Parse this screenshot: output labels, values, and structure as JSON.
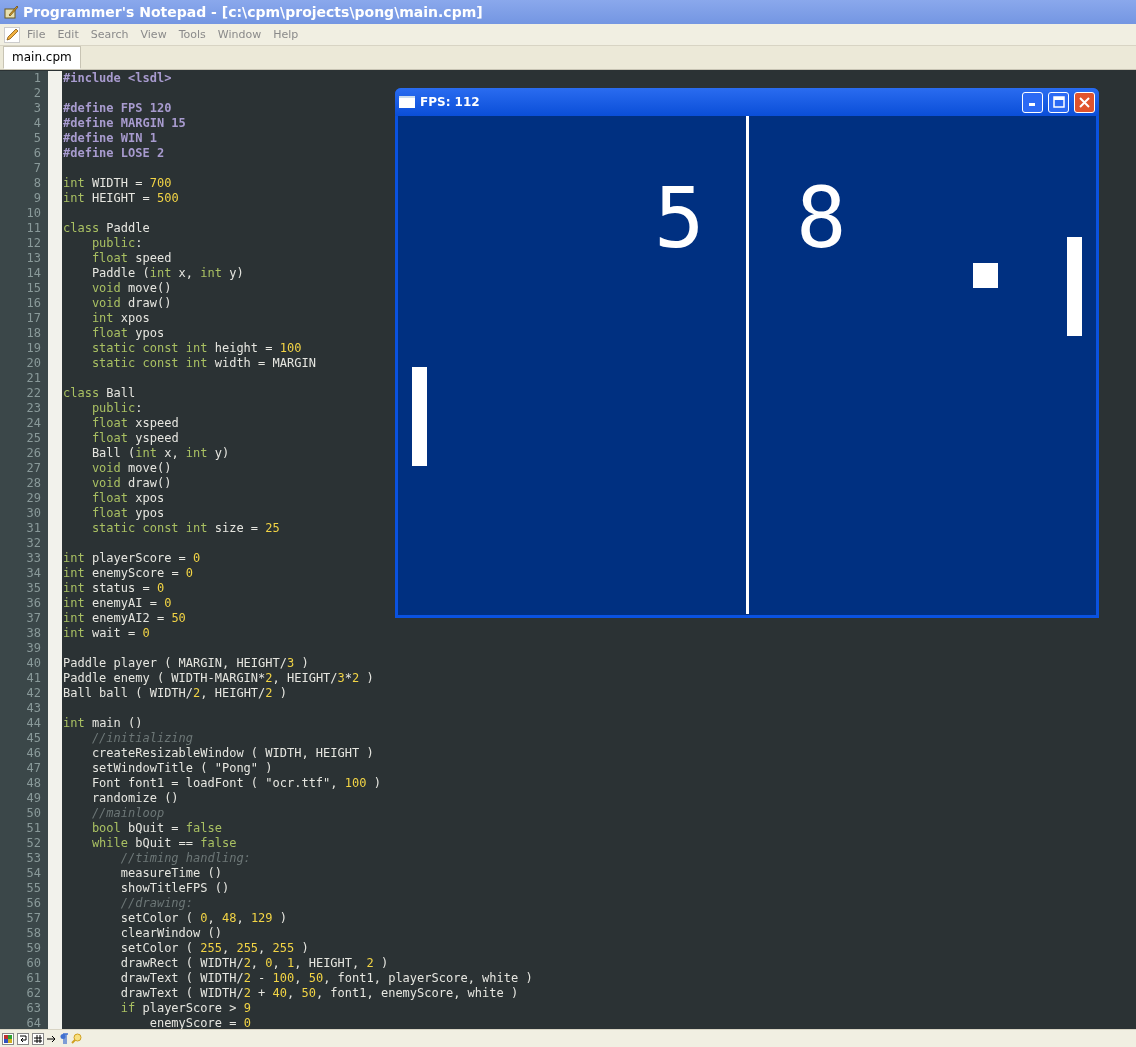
{
  "window": {
    "title": "Programmer's Notepad - [c:\\cpm\\projects\\pong\\main.cpm]"
  },
  "menu": [
    "File",
    "Edit",
    "Search",
    "View",
    "Tools",
    "Window",
    "Help"
  ],
  "tabs": [
    {
      "label": "main.cpm",
      "selected": true
    }
  ],
  "code_lines": [
    {
      "number": "1",
      "tokens": [
        {
          "kind": "pp",
          "text": "#include <lsdl>"
        }
      ]
    },
    {
      "number": "2"
    },
    {
      "number": "3",
      "tokens": [
        {
          "kind": "pp",
          "text": "#define FPS 120"
        }
      ]
    },
    {
      "number": "4",
      "tokens": [
        {
          "kind": "pp",
          "text": "#define MARGIN 15"
        }
      ]
    },
    {
      "number": "5",
      "tokens": [
        {
          "kind": "pp",
          "text": "#define WIN 1"
        }
      ]
    },
    {
      "number": "6",
      "tokens": [
        {
          "kind": "pp",
          "text": "#define LOSE 2"
        }
      ]
    },
    {
      "number": "7"
    },
    {
      "number": "8",
      "tokens": [
        {
          "kind": "kw",
          "text": "int"
        },
        {
          "kind": "plain",
          "text": " WIDTH = "
        },
        {
          "kind": "num",
          "text": "700"
        }
      ]
    },
    {
      "number": "9",
      "tokens": [
        {
          "kind": "kw",
          "text": "int"
        },
        {
          "kind": "plain",
          "text": " HEIGHT = "
        },
        {
          "kind": "num",
          "text": "500"
        }
      ]
    },
    {
      "number": "10"
    },
    {
      "number": "11",
      "tokens": [
        {
          "kind": "kw",
          "text": "class"
        },
        {
          "kind": "plain",
          "text": " Paddle"
        }
      ]
    },
    {
      "number": "12",
      "tokens": [
        {
          "kind": "kw",
          "text": "    public"
        },
        {
          "kind": "plain",
          "text": ":"
        }
      ]
    },
    {
      "number": "13",
      "tokens": [
        {
          "kind": "kw",
          "text": "    float"
        },
        {
          "kind": "plain",
          "text": " speed"
        }
      ]
    },
    {
      "number": "14",
      "tokens": [
        {
          "kind": "plain",
          "text": "    Paddle ("
        },
        {
          "kind": "kw",
          "text": "int"
        },
        {
          "kind": "plain",
          "text": " x, "
        },
        {
          "kind": "kw",
          "text": "int"
        },
        {
          "kind": "plain",
          "text": " y)"
        }
      ]
    },
    {
      "number": "15",
      "tokens": [
        {
          "kind": "kw",
          "text": "    void"
        },
        {
          "kind": "plain",
          "text": " move()"
        }
      ]
    },
    {
      "number": "16",
      "tokens": [
        {
          "kind": "kw",
          "text": "    void"
        },
        {
          "kind": "plain",
          "text": " draw()"
        }
      ]
    },
    {
      "number": "17",
      "tokens": [
        {
          "kind": "kw",
          "text": "    int"
        },
        {
          "kind": "plain",
          "text": " xpos"
        }
      ]
    },
    {
      "number": "18",
      "tokens": [
        {
          "kind": "kw",
          "text": "    float"
        },
        {
          "kind": "plain",
          "text": " ypos"
        }
      ]
    },
    {
      "number": "19",
      "tokens": [
        {
          "kind": "kw",
          "text": "    static const int"
        },
        {
          "kind": "plain",
          "text": " height = "
        },
        {
          "kind": "num",
          "text": "100"
        }
      ]
    },
    {
      "number": "20",
      "tokens": [
        {
          "kind": "kw",
          "text": "    static const int"
        },
        {
          "kind": "plain",
          "text": " width = MARGIN"
        }
      ]
    },
    {
      "number": "21"
    },
    {
      "number": "22",
      "tokens": [
        {
          "kind": "kw",
          "text": "class"
        },
        {
          "kind": "plain",
          "text": " Ball"
        }
      ]
    },
    {
      "number": "23",
      "tokens": [
        {
          "kind": "kw",
          "text": "    public"
        },
        {
          "kind": "plain",
          "text": ":"
        }
      ]
    },
    {
      "number": "24",
      "tokens": [
        {
          "kind": "kw",
          "text": "    float"
        },
        {
          "kind": "plain",
          "text": " xspeed"
        }
      ]
    },
    {
      "number": "25",
      "tokens": [
        {
          "kind": "kw",
          "text": "    float"
        },
        {
          "kind": "plain",
          "text": " yspeed"
        }
      ]
    },
    {
      "number": "26",
      "tokens": [
        {
          "kind": "plain",
          "text": "    Ball ("
        },
        {
          "kind": "kw",
          "text": "int"
        },
        {
          "kind": "plain",
          "text": " x, "
        },
        {
          "kind": "kw",
          "text": "int"
        },
        {
          "kind": "plain",
          "text": " y)"
        }
      ]
    },
    {
      "number": "27",
      "tokens": [
        {
          "kind": "kw",
          "text": "    void"
        },
        {
          "kind": "plain",
          "text": " move()"
        }
      ]
    },
    {
      "number": "28",
      "tokens": [
        {
          "kind": "kw",
          "text": "    void"
        },
        {
          "kind": "plain",
          "text": " draw()"
        }
      ]
    },
    {
      "number": "29",
      "tokens": [
        {
          "kind": "kw",
          "text": "    float"
        },
        {
          "kind": "plain",
          "text": " xpos"
        }
      ]
    },
    {
      "number": "30",
      "tokens": [
        {
          "kind": "kw",
          "text": "    float"
        },
        {
          "kind": "plain",
          "text": " ypos"
        }
      ]
    },
    {
      "number": "31",
      "tokens": [
        {
          "kind": "kw",
          "text": "    static const int"
        },
        {
          "kind": "plain",
          "text": " size = "
        },
        {
          "kind": "num",
          "text": "25"
        }
      ]
    },
    {
      "number": "32"
    },
    {
      "number": "33",
      "tokens": [
        {
          "kind": "kw",
          "text": "int"
        },
        {
          "kind": "plain",
          "text": " playerScore = "
        },
        {
          "kind": "num",
          "text": "0"
        }
      ]
    },
    {
      "number": "34",
      "tokens": [
        {
          "kind": "kw",
          "text": "int"
        },
        {
          "kind": "plain",
          "text": " enemyScore = "
        },
        {
          "kind": "num",
          "text": "0"
        }
      ]
    },
    {
      "number": "35",
      "tokens": [
        {
          "kind": "kw",
          "text": "int"
        },
        {
          "kind": "plain",
          "text": " status = "
        },
        {
          "kind": "num",
          "text": "0"
        }
      ]
    },
    {
      "number": "36",
      "tokens": [
        {
          "kind": "kw",
          "text": "int"
        },
        {
          "kind": "plain",
          "text": " enemyAI = "
        },
        {
          "kind": "num",
          "text": "0"
        }
      ]
    },
    {
      "number": "37",
      "tokens": [
        {
          "kind": "kw",
          "text": "int"
        },
        {
          "kind": "plain",
          "text": " enemyAI2 = "
        },
        {
          "kind": "num",
          "text": "50"
        }
      ]
    },
    {
      "number": "38",
      "tokens": [
        {
          "kind": "kw",
          "text": "int"
        },
        {
          "kind": "plain",
          "text": " wait = "
        },
        {
          "kind": "num",
          "text": "0"
        }
      ]
    },
    {
      "number": "39"
    },
    {
      "number": "40",
      "tokens": [
        {
          "kind": "plain",
          "text": "Paddle player ( MARGIN, HEIGHT/"
        },
        {
          "kind": "num",
          "text": "3"
        },
        {
          "kind": "plain",
          "text": " )"
        }
      ]
    },
    {
      "number": "41",
      "tokens": [
        {
          "kind": "plain",
          "text": "Paddle enemy ( WIDTH-MARGIN*"
        },
        {
          "kind": "num",
          "text": "2"
        },
        {
          "kind": "plain",
          "text": ", HEIGHT/"
        },
        {
          "kind": "num",
          "text": "3"
        },
        {
          "kind": "plain",
          "text": "*"
        },
        {
          "kind": "num",
          "text": "2"
        },
        {
          "kind": "plain",
          "text": " )"
        }
      ]
    },
    {
      "number": "42",
      "tokens": [
        {
          "kind": "plain",
          "text": "Ball ball ( WIDTH/"
        },
        {
          "kind": "num",
          "text": "2"
        },
        {
          "kind": "plain",
          "text": ", HEIGHT/"
        },
        {
          "kind": "num",
          "text": "2"
        },
        {
          "kind": "plain",
          "text": " )"
        }
      ]
    },
    {
      "number": "43"
    },
    {
      "number": "44",
      "tokens": [
        {
          "kind": "kw",
          "text": "int"
        },
        {
          "kind": "plain",
          "text": " main ()"
        }
      ]
    },
    {
      "number": "45",
      "tokens": [
        {
          "kind": "comment",
          "text": "    //initializing"
        }
      ]
    },
    {
      "number": "46",
      "tokens": [
        {
          "kind": "plain",
          "text": "    createResizableWindow ( WIDTH, HEIGHT )"
        }
      ]
    },
    {
      "number": "47",
      "tokens": [
        {
          "kind": "plain",
          "text": "    setWindowTitle ( \"Pong\" )"
        }
      ]
    },
    {
      "number": "48",
      "tokens": [
        {
          "kind": "plain",
          "text": "    Font font1 = loadFont ( \"ocr.ttf\", "
        },
        {
          "kind": "num",
          "text": "100"
        },
        {
          "kind": "plain",
          "text": " )"
        }
      ]
    },
    {
      "number": "49",
      "tokens": [
        {
          "kind": "plain",
          "text": "    randomize ()"
        }
      ]
    },
    {
      "number": "50",
      "tokens": [
        {
          "kind": "comment",
          "text": "    //mainloop"
        }
      ]
    },
    {
      "number": "51",
      "tokens": [
        {
          "kind": "kw",
          "text": "    bool"
        },
        {
          "kind": "plain",
          "text": " bQuit = "
        },
        {
          "kind": "kw",
          "text": "false"
        }
      ]
    },
    {
      "number": "52",
      "tokens": [
        {
          "kind": "kw",
          "text": "    while"
        },
        {
          "kind": "plain",
          "text": " bQuit == "
        },
        {
          "kind": "kw",
          "text": "false"
        }
      ]
    },
    {
      "number": "53",
      "tokens": [
        {
          "kind": "comment",
          "text": "        //timing handling:"
        }
      ]
    },
    {
      "number": "54",
      "tokens": [
        {
          "kind": "plain",
          "text": "        measureTime ()"
        }
      ]
    },
    {
      "number": "55",
      "tokens": [
        {
          "kind": "plain",
          "text": "        showTitleFPS ()"
        }
      ]
    },
    {
      "number": "56",
      "tokens": [
        {
          "kind": "comment",
          "text": "        //drawing:"
        }
      ]
    },
    {
      "number": "57",
      "tokens": [
        {
          "kind": "plain",
          "text": "        setColor ( "
        },
        {
          "kind": "num",
          "text": "0"
        },
        {
          "kind": "plain",
          "text": ", "
        },
        {
          "kind": "num",
          "text": "48"
        },
        {
          "kind": "plain",
          "text": ", "
        },
        {
          "kind": "num",
          "text": "129"
        },
        {
          "kind": "plain",
          "text": " )"
        }
      ]
    },
    {
      "number": "58",
      "tokens": [
        {
          "kind": "plain",
          "text": "        clearWindow ()"
        }
      ]
    },
    {
      "number": "59",
      "tokens": [
        {
          "kind": "plain",
          "text": "        setColor ( "
        },
        {
          "kind": "num",
          "text": "255"
        },
        {
          "kind": "plain",
          "text": ", "
        },
        {
          "kind": "num",
          "text": "255"
        },
        {
          "kind": "plain",
          "text": ", "
        },
        {
          "kind": "num",
          "text": "255"
        },
        {
          "kind": "plain",
          "text": " )"
        }
      ]
    },
    {
      "number": "60",
      "tokens": [
        {
          "kind": "plain",
          "text": "        drawRect ( WIDTH/"
        },
        {
          "kind": "num",
          "text": "2"
        },
        {
          "kind": "plain",
          "text": ", "
        },
        {
          "kind": "num",
          "text": "0"
        },
        {
          "kind": "plain",
          "text": ", "
        },
        {
          "kind": "num",
          "text": "1"
        },
        {
          "kind": "plain",
          "text": ", HEIGHT, "
        },
        {
          "kind": "num",
          "text": "2"
        },
        {
          "kind": "plain",
          "text": " )"
        }
      ]
    },
    {
      "number": "61",
      "tokens": [
        {
          "kind": "plain",
          "text": "        drawText ( WIDTH/"
        },
        {
          "kind": "num",
          "text": "2"
        },
        {
          "kind": "plain",
          "text": " - "
        },
        {
          "kind": "num",
          "text": "100"
        },
        {
          "kind": "plain",
          "text": ", "
        },
        {
          "kind": "num",
          "text": "50"
        },
        {
          "kind": "plain",
          "text": ", font1, playerScore, white )"
        }
      ]
    },
    {
      "number": "62",
      "tokens": [
        {
          "kind": "plain",
          "text": "        drawText ( WIDTH/"
        },
        {
          "kind": "num",
          "text": "2"
        },
        {
          "kind": "plain",
          "text": " + "
        },
        {
          "kind": "num",
          "text": "40"
        },
        {
          "kind": "plain",
          "text": ", "
        },
        {
          "kind": "num",
          "text": "50"
        },
        {
          "kind": "plain",
          "text": ", font1, enemyScore, white )"
        }
      ]
    },
    {
      "number": "63",
      "tokens": [
        {
          "kind": "kw",
          "text": "        if"
        },
        {
          "kind": "plain",
          "text": " playerScore > "
        },
        {
          "kind": "num",
          "text": "9"
        }
      ]
    },
    {
      "number": "64",
      "tokens": [
        {
          "kind": "plain",
          "text": "            enemyScore = "
        },
        {
          "kind": "num",
          "text": "0"
        }
      ]
    }
  ],
  "game_window": {
    "title": "FPS: 112",
    "player_score": "5",
    "enemy_score": "8"
  }
}
